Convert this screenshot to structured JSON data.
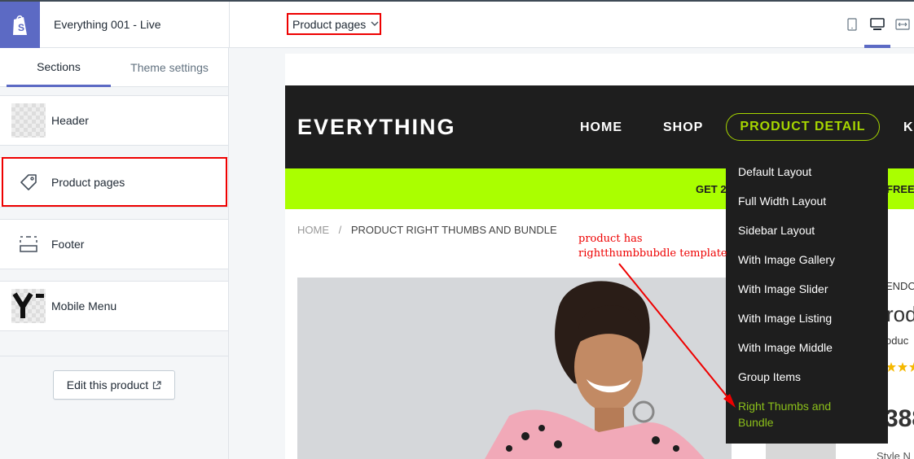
{
  "topbar": {
    "store_name": "Everything 001 - Live",
    "page_select": "Product pages",
    "devices": [
      "mobile-icon",
      "desktop-icon",
      "fullscreen-icon"
    ]
  },
  "sidebar": {
    "tabs": [
      {
        "label": "Sections",
        "active": true
      },
      {
        "label": "Theme settings",
        "active": false
      }
    ],
    "sections": [
      {
        "label": "Header"
      },
      {
        "label": "Product pages"
      },
      {
        "label": "Footer"
      },
      {
        "label": "Mobile Menu"
      }
    ],
    "edit_button": "Edit this product"
  },
  "preview": {
    "logo": "EVERYTHING",
    "nav": [
      "HOME",
      "SHOP",
      "PRODUCT DETAIL",
      "K"
    ],
    "promo_left": "GET 2",
    "promo_right": "FREE",
    "breadcrumb": {
      "home": "HOME",
      "sep": "/",
      "current": "PRODUCT RIGHT THUMBS AND BUNDLE"
    },
    "side_fragments": [
      "ENDO",
      "rod",
      "oduc",
      "388",
      "Style N"
    ],
    "dropdown": [
      {
        "label": "Default Layout"
      },
      {
        "label": "Full Width Layout"
      },
      {
        "label": "Sidebar Layout"
      },
      {
        "label": "With Image Gallery"
      },
      {
        "label": "With Image Slider"
      },
      {
        "label": "With Image Listing"
      },
      {
        "label": "With Image Middle"
      },
      {
        "label": "Group Items"
      },
      {
        "label": "Right Thumbs and Bundle",
        "active": true
      }
    ]
  },
  "annotation": {
    "line1": "product has",
    "line2": "rightthumbbubdle template"
  },
  "colors": {
    "accent": "#5c6ac4",
    "highlight_red": "#ee0000",
    "lime": "#aaff00",
    "active_green": "#8bbf1a"
  }
}
